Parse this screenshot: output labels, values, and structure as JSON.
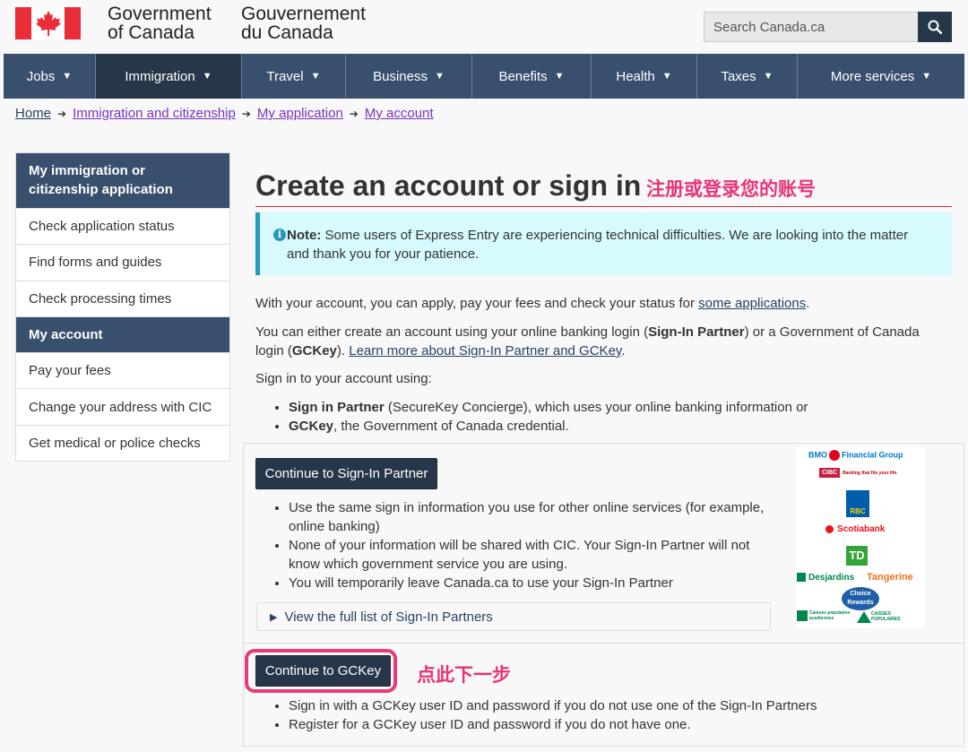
{
  "header": {
    "wordmark_en": [
      "Government",
      "of Canada"
    ],
    "wordmark_fr": [
      "Gouvernement",
      "du Canada"
    ],
    "search_placeholder": "Search Canada.ca"
  },
  "nav": [
    {
      "label": "Jobs",
      "active": false
    },
    {
      "label": "Immigration",
      "active": true
    },
    {
      "label": "Travel",
      "active": false
    },
    {
      "label": "Business",
      "active": false
    },
    {
      "label": "Benefits",
      "active": false
    },
    {
      "label": "Health",
      "active": false
    },
    {
      "label": "Taxes",
      "active": false
    },
    {
      "label": "More services",
      "active": false
    }
  ],
  "breadcrumb": [
    "Home",
    "Immigration and citizenship",
    "My application",
    "My account"
  ],
  "sidebar": {
    "heading": "My immigration or citizenship application",
    "items": [
      {
        "label": "Check application status",
        "active": false
      },
      {
        "label": "Find forms and guides",
        "active": false
      },
      {
        "label": "Check processing times",
        "active": false
      },
      {
        "label": "My account",
        "active": true
      },
      {
        "label": "Pay your fees",
        "active": false
      },
      {
        "label": "Change your address with CIC",
        "active": false
      },
      {
        "label": "Get medical or police checks",
        "active": false
      }
    ]
  },
  "main": {
    "title": "Create an account or sign in",
    "title_annotation": "注册或登录您的账号",
    "note": {
      "label": "Note:",
      "text": " Some users of Express Entry are experiencing technical difficulties. We are looking into the matter and thank you for your patience."
    },
    "intro1_pre": "With your account, you can apply, pay your fees and check your status for ",
    "intro1_link": "some applications",
    "intro1_post": ".",
    "intro2_a": "You can either create an account using your online banking login (",
    "intro2_b": "Sign-In Partner",
    "intro2_c": ") or a Government of Canada login (",
    "intro2_d": "GCKey",
    "intro2_e": "). ",
    "intro2_link": "Learn more about Sign-In Partner and GCKey",
    "intro2_f": ".",
    "signin_using": "Sign in to your account using:",
    "options": [
      {
        "bold": "Sign in Partner",
        "text": " (SecureKey Concierge), which uses your online banking information or"
      },
      {
        "bold": "GCKey",
        "text": ", the Government of Canada credential."
      }
    ],
    "partner_button": "Continue to Sign-In Partner",
    "partner_points": [
      "Use the same sign in information you use for other online services (for example, online banking)",
      "None of your information will be shared with CIC. Your Sign-In Partner will not know which government service you are using.",
      "You will temporarily leave Canada.ca to use your Sign-In Partner"
    ],
    "partner_list_toggle": "View the full list of Sign-In Partners",
    "gckey_button": "Continue to GCKey",
    "gckey_annotation": "点此下一步",
    "gckey_points": [
      "Sign in with a GCKey user ID and password if you do not use one of the Sign-In Partners",
      "Register for a GCKey user ID and password if you do not have one."
    ]
  },
  "banks": {
    "bmo": [
      "BMO",
      "Financial Group"
    ],
    "cibc": [
      "CIBC",
      "Banking that fits your life."
    ],
    "rbc": "RBC",
    "scotiabank": "Scotiabank",
    "td": "TD",
    "desjardins": "Desjardins",
    "tangerine": "Tangerine",
    "choice": [
      "Choice",
      "Rewards"
    ],
    "caisses_acadiennes": [
      "Caisses populaires",
      "acadiennes"
    ],
    "caisses_populaires": [
      "CAISSES",
      "POPULAIRES"
    ]
  },
  "colors": {
    "nav_bg": "#38506d",
    "nav_active": "#26374a",
    "note_bg": "#d7faff",
    "annotation": "#e8347a",
    "flag_red": "#eb2d37"
  }
}
